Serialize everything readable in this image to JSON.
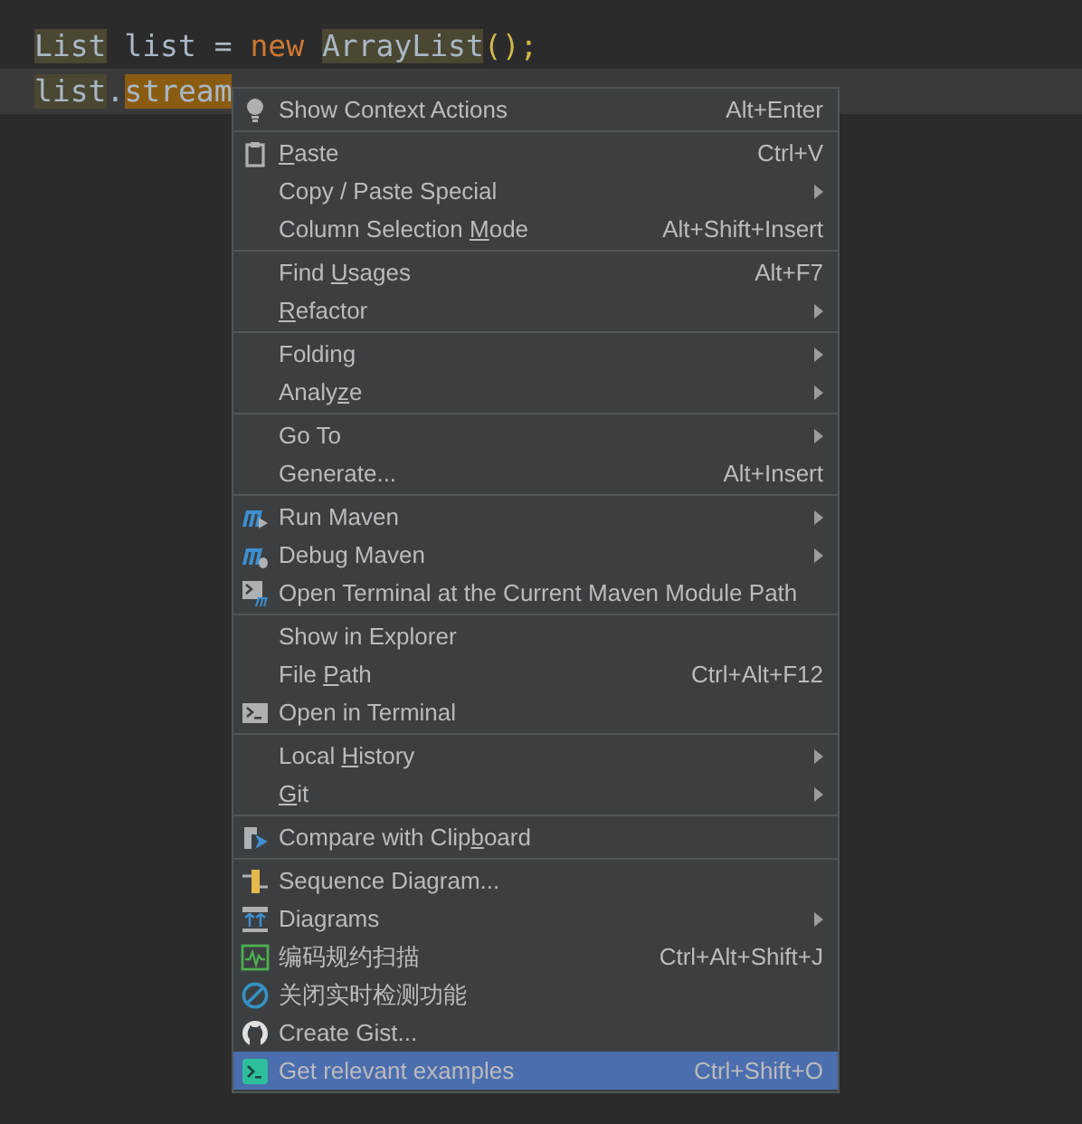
{
  "editor": {
    "lines": [
      {
        "current": false,
        "tokens": [
          {
            "text": "List",
            "kind": "usage"
          },
          {
            "text": " list = ",
            "kind": "plain"
          },
          {
            "text": "new ",
            "kind": "keyword"
          },
          {
            "text": "ArrayList",
            "kind": "usage"
          },
          {
            "text": "();",
            "kind": "paren"
          }
        ]
      },
      {
        "current": true,
        "tokens": [
          {
            "text": "list",
            "kind": "usage"
          },
          {
            "text": ".",
            "kind": "plain"
          },
          {
            "text": "stream",
            "kind": "match"
          }
        ]
      }
    ]
  },
  "context_menu": {
    "groups": [
      [
        {
          "kind": "bulb",
          "label": "Show Context Actions",
          "shortcut": "Alt+Enter",
          "submenu": false,
          "selected": false
        }
      ],
      [
        {
          "kind": "clipboard",
          "mnemonic": "P",
          "after": "aste",
          "shortcut": "Ctrl+V",
          "submenu": false,
          "selected": false
        },
        {
          "kind": "plain",
          "label": "Copy / Paste Special",
          "submenu": true,
          "selected": false
        },
        {
          "kind": "plain",
          "before": "Column Selection ",
          "mnemonic": "M",
          "after": "ode",
          "shortcut": "Alt+Shift+Insert",
          "submenu": false,
          "selected": false
        }
      ],
      [
        {
          "kind": "plain",
          "before": "Find ",
          "mnemonic": "U",
          "after": "sages",
          "shortcut": "Alt+F7",
          "submenu": false,
          "selected": false
        },
        {
          "kind": "plain",
          "mnemonic": "R",
          "after": "efactor",
          "submenu": true,
          "selected": false
        }
      ],
      [
        {
          "kind": "plain",
          "label": "Folding",
          "submenu": true,
          "selected": false
        },
        {
          "kind": "plain",
          "before": "Analy",
          "mnemonic": "z",
          "after": "e",
          "submenu": true,
          "selected": false
        }
      ],
      [
        {
          "kind": "plain",
          "label": "Go To",
          "submenu": true,
          "selected": false
        },
        {
          "kind": "plain",
          "label": "Generate...",
          "shortcut": "Alt+Insert",
          "submenu": false,
          "selected": false
        }
      ],
      [
        {
          "kind": "mavenrun",
          "label": "Run Maven",
          "submenu": true,
          "selected": false
        },
        {
          "kind": "mavendebug",
          "label": "Debug Maven",
          "submenu": true,
          "selected": false
        },
        {
          "kind": "maventerminal",
          "label": "Open Terminal at the Current Maven Module Path",
          "submenu": false,
          "selected": false
        }
      ],
      [
        {
          "kind": "plain",
          "label": "Show in Explorer",
          "submenu": false,
          "selected": false
        },
        {
          "kind": "plain",
          "before": "File ",
          "mnemonic": "P",
          "after": "ath",
          "shortcut": "Ctrl+Alt+F12",
          "submenu": false,
          "selected": false
        },
        {
          "kind": "terminal",
          "label": "Open in Terminal",
          "submenu": false,
          "selected": false
        }
      ],
      [
        {
          "kind": "plain",
          "before": "Local ",
          "mnemonic": "H",
          "after": "istory",
          "submenu": true,
          "selected": false
        },
        {
          "kind": "plain",
          "mnemonic": "G",
          "after": "it",
          "submenu": true,
          "selected": false
        }
      ],
      [
        {
          "kind": "compare",
          "before": "Compare with Clip",
          "mnemonic": "b",
          "after": "oard",
          "submenu": false,
          "selected": false
        }
      ],
      [
        {
          "kind": "sequence",
          "label": "Sequence Diagram...",
          "submenu": false,
          "selected": false
        },
        {
          "kind": "diagrams",
          "label": "Diagrams",
          "submenu": true,
          "selected": false
        },
        {
          "kind": "scan",
          "label": "编码规约扫描",
          "shortcut": "Ctrl+Alt+Shift+J",
          "submenu": false,
          "selected": false
        },
        {
          "kind": "forbid",
          "label": "关闭实时检测功能",
          "submenu": false,
          "selected": false
        },
        {
          "kind": "github",
          "label": "Create Gist...",
          "submenu": false,
          "selected": false
        },
        {
          "kind": "examples",
          "label": "Get relevant examples",
          "shortcut": "Ctrl+Shift+O",
          "submenu": false,
          "selected": true
        }
      ]
    ]
  }
}
